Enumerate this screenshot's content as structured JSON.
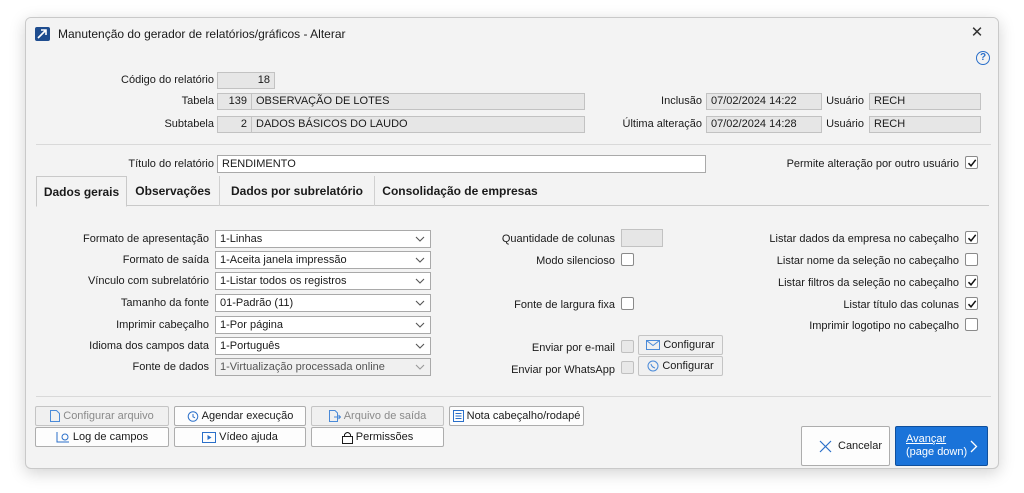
{
  "window": {
    "title": "Manutenção do gerador de relatórios/gráficos - Alterar",
    "close_glyph": "✕",
    "help_glyph": "?"
  },
  "header": {
    "codigo_label": "Código do relatório",
    "codigo_value": "18",
    "tabela_label": "Tabela",
    "tabela_num": "139",
    "tabela_name": "OBSERVAÇÃO DE LOTES",
    "subtabela_label": "Subtabela",
    "subtabela_num": "2",
    "subtabela_name": "DADOS BÁSICOS DO LAUDO",
    "inclusao_label": "Inclusão",
    "inclusao_value": "07/02/2024 14:22",
    "ultima_label": "Última alteração",
    "ultima_value": "07/02/2024 14:28",
    "usuario_label": "Usuário",
    "usuario1_value": "RECH",
    "usuario2_value": "RECH",
    "titulo_label": "Título do relatório",
    "titulo_value": "RENDIMENTO",
    "permite_label": "Permite alteração por outro usuário",
    "permite_checked": true
  },
  "tabs": [
    "Dados gerais",
    "Observações",
    "Dados por subrelatório",
    "Consolidação de empresas"
  ],
  "form": {
    "formato_apresentacao_label": "Formato de apresentação",
    "formato_apresentacao_value": "1-Linhas",
    "formato_saida_label": "Formato de saída",
    "formato_saida_value": "1-Aceita janela impressão",
    "vinculo_label": "Vínculo com subrelatório",
    "vinculo_value": "1-Listar todos os registros",
    "tamanho_fonte_label": "Tamanho da fonte",
    "tamanho_fonte_value": "01-Padrão (11)",
    "imprimir_cab_label": "Imprimir cabeçalho",
    "imprimir_cab_value": "1-Por página",
    "idioma_label": "Idioma dos campos data",
    "idioma_value": "1-Português",
    "fonte_dados_label": "Fonte de dados",
    "fonte_dados_value": "1-Virtualização processada online",
    "qtd_colunas_label": "Quantidade de colunas",
    "modo_silencioso_label": "Modo silencioso",
    "fonte_fixa_label": "Fonte de largura fixa",
    "email_label": "Enviar por e-mail",
    "whatsapp_label": "Enviar por WhatsApp",
    "configurar_label": "Configurar",
    "listar_empresa_label": "Listar dados da empresa no cabeçalho",
    "listar_empresa_checked": true,
    "listar_nome_sel_label": "Listar nome da seleção no cabeçalho",
    "listar_nome_sel_checked": false,
    "listar_filtros_label": "Listar filtros da seleção no cabeçalho",
    "listar_filtros_checked": true,
    "listar_titulo_label": "Listar título das colunas",
    "listar_titulo_checked": true,
    "imprimir_logo_label": "Imprimir logotipo no cabeçalho",
    "imprimir_logo_checked": false
  },
  "footer": {
    "configurar_arquivo": "Configurar arquivo",
    "agendar_execucao": "Agendar execução",
    "arquivo_saida": "Arquivo de saída",
    "nota_cabecalho": "Nota cabeçalho/rodapé",
    "log_campos": "Log de campos",
    "video_ajuda": "Vídeo ajuda",
    "permissoes": "Permissões",
    "cancelar": "Cancelar",
    "avancar": "Avançar",
    "avancar_sub": "(page down)"
  },
  "colors": {
    "accent": "#1a73d9",
    "title_icon": "#1f4d8f"
  }
}
